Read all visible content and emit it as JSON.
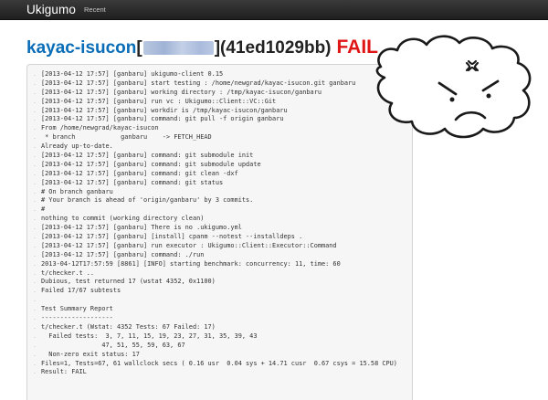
{
  "nav": {
    "brand": "Ukigumo",
    "recent": "Recent"
  },
  "header": {
    "repo": "kayac-isucon",
    "bracket_open": "[",
    "commit": "](41ed1029bb)",
    "status": "FAIL",
    "status_color": "#e01515",
    "repo_color": "#0a6db8"
  },
  "log_lines": [
    "[2013-04-12 17:57] [ganbaru] ukigumo-client 0.15",
    "[2013-04-12 17:57] [ganbaru] start testing : /home/newgrad/kayac-isucon.git ganbaru",
    "[2013-04-12 17:57] [ganbaru] working directory : /tmp/kayac-isucon/ganbaru",
    "[2013-04-12 17:57] [ganbaru] run vc : Ukigumo::Client::VC::Git",
    "[2013-04-12 17:57] [ganbaru] workdir is /tmp/kayac-isucon/ganbaru",
    "[2013-04-12 17:57] [ganbaru] command: git pull -f origin ganbaru",
    "From /home/newgrad/kayac-isucon",
    " * branch            ganbaru    -> FETCH_HEAD",
    "Already up-to-date.",
    "[2013-04-12 17:57] [ganbaru] command: git submodule init",
    "[2013-04-12 17:57] [ganbaru] command: git submodule update",
    "[2013-04-12 17:57] [ganbaru] command: git clean -dxf",
    "[2013-04-12 17:57] [ganbaru] command: git status",
    "# On branch ganbaru",
    "# Your branch is ahead of 'origin/ganbaru' by 3 commits.",
    "#",
    "nothing to commit (working directory clean)",
    "[2013-04-12 17:57] [ganbaru] There is no .ukigumo.yml",
    "[2013-04-12 17:57] [ganbaru] [install] cpanm --notest --installdeps .",
    "[2013-04-12 17:57] [ganbaru] run executor : Ukigumo::Client::Executor::Command",
    "[2013-04-12 17:57] [ganbaru] command: ./run",
    "2013-04-12T17:57:59 [8861] [INFO] starting benchmark: concurrency: 11, time: 60",
    "t/checker.t ..",
    "Dubious, test returned 17 (wstat 4352, 0x1100)",
    "Failed 17/67 subtests",
    "",
    "Test Summary Report",
    "-------------------",
    "t/checker.t (Wstat: 4352 Tests: 67 Failed: 17)",
    "  Failed tests:  3, 7, 11, 15, 19, 23, 27, 31, 35, 39, 43",
    "                47, 51, 55, 59, 63, 67",
    "  Non-zero exit status: 17",
    "Files=1, Tests=67, 61 wallclock secs ( 0.16 usr  0.04 sys + 14.71 cusr  0.67 csys = 15.58 CPU)",
    "Result: FAIL"
  ]
}
